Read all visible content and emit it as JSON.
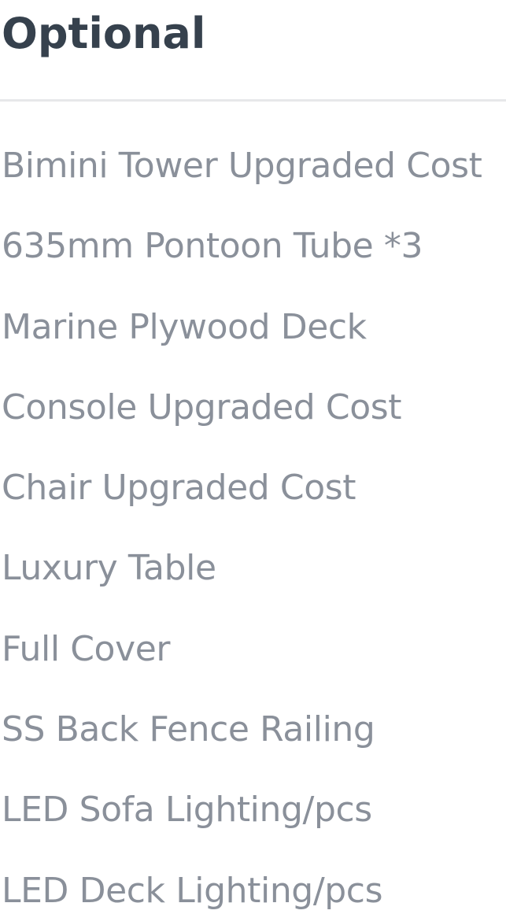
{
  "section": {
    "title": "Optional"
  },
  "options": {
    "items": [
      "Bimini Tower Upgraded Cost",
      "635mm Pontoon Tube *3",
      "Marine Plywood Deck",
      "Console Upgraded Cost",
      "Chair Upgraded Cost",
      "Luxury Table",
      "Full Cover",
      "SS Back Fence Railing",
      "LED Sofa Lighting/pcs",
      "LED Deck Lighting/pcs"
    ]
  },
  "colors": {
    "heading": "#36414d",
    "item_text": "#8a909a",
    "divider": "#e7e8ea",
    "background": "#ffffff"
  }
}
